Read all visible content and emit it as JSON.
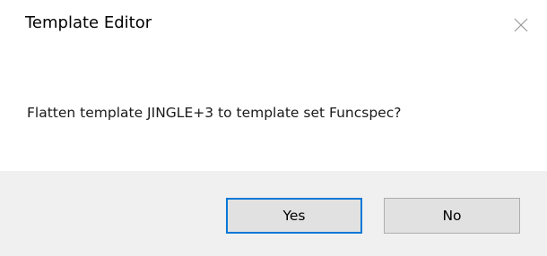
{
  "dialog": {
    "title": "Template Editor",
    "close_icon": "close-icon",
    "message": "Flatten template JINGLE+3 to template set Funcspec?",
    "buttons": {
      "yes_label": "Yes",
      "no_label": "No"
    }
  },
  "colors": {
    "background": "#ffffff",
    "footer_background": "#f0f0f0",
    "button_background": "#e1e1e1",
    "default_button_border": "#0078d7"
  }
}
